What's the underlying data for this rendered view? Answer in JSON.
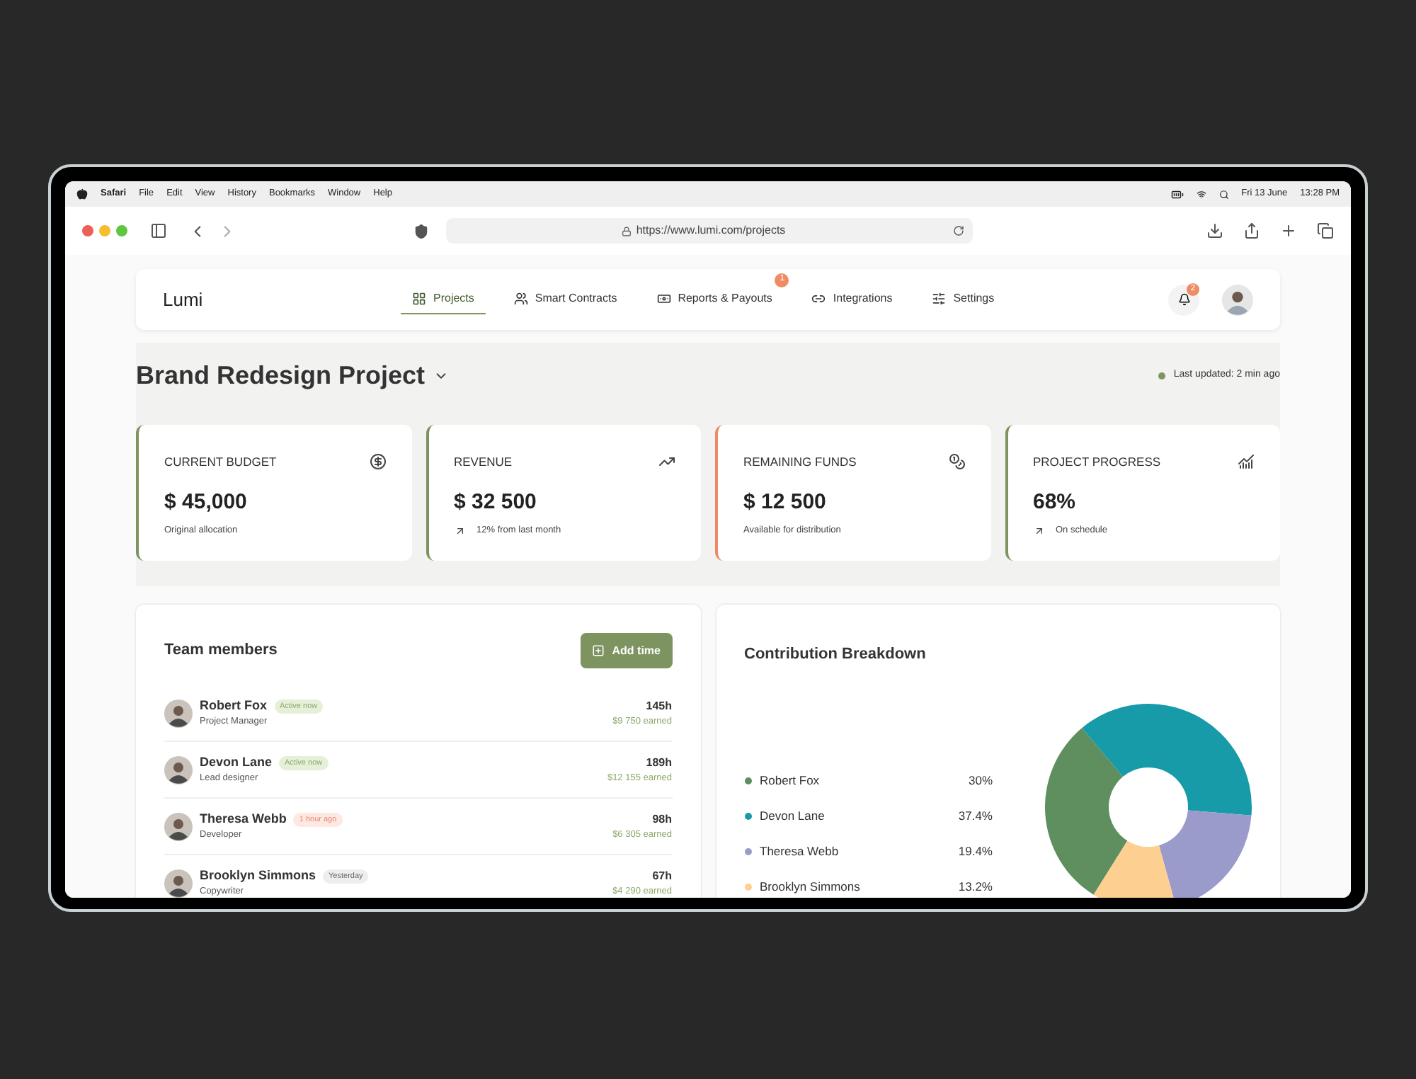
{
  "menubar": {
    "items": [
      "Safari",
      "File",
      "Edit",
      "View",
      "History",
      "Bookmarks",
      "Window",
      "Help"
    ],
    "date": "Fri 13 June",
    "time": "13:28 PM"
  },
  "browser": {
    "url": "https://www.lumi.com/projects"
  },
  "header": {
    "logo": "Lumi",
    "notifications": "2",
    "nav": [
      {
        "label": "Projects",
        "selected": true
      },
      {
        "label": "Smart Contracts",
        "selected": false
      },
      {
        "label": "Reports & Payouts",
        "selected": false,
        "badge": "1"
      },
      {
        "label": "Integrations",
        "selected": false
      },
      {
        "label": "Settings",
        "selected": false
      }
    ]
  },
  "project": {
    "title": "Brand Redesign Project",
    "updated": "Last updated: 2 min ago"
  },
  "stats": [
    {
      "label": "CURRENT BUDGET",
      "value": "$ 45,000",
      "note": "Original allocation",
      "trend": false,
      "color": "#7d9460"
    },
    {
      "label": "REVENUE",
      "value": "$ 32 500",
      "note": "12% from last month",
      "trend": true,
      "color": "#7d9460"
    },
    {
      "label": "REMAINING FUNDS",
      "value": "$ 12 500",
      "note": "Available for distribution",
      "trend": false,
      "color": "#ec8a68"
    },
    {
      "label": "PROJECT PROGRESS",
      "value": "68%",
      "note": "On schedule",
      "trend": true,
      "color": "#7d9460"
    }
  ],
  "team": {
    "title": "Team members",
    "button": "Add time",
    "members": [
      {
        "name": "Robert Fox",
        "role": "Project Manager",
        "status": "Active now",
        "kind": "active",
        "hours": "145h",
        "earned": "$9 750 earned"
      },
      {
        "name": "Devon Lane",
        "role": "Lead designer",
        "status": "Active now",
        "kind": "active",
        "hours": "189h",
        "earned": "$12 155 earned"
      },
      {
        "name": "Theresa Webb",
        "role": "Developer",
        "status": "1 hour ago",
        "kind": "recent",
        "hours": "98h",
        "earned": "$6 305 earned"
      },
      {
        "name": "Brooklyn Simmons",
        "role": "Copywriter",
        "status": "Yesterday",
        "kind": "away",
        "hours": "67h",
        "earned": "$4 290 earned"
      }
    ]
  },
  "contribution": {
    "title": "Contribution Breakdown",
    "legend": [
      {
        "value": "30%",
        "color": "#5f8f5e"
      },
      {
        "value": "37.4%",
        "color": "#179ba9"
      },
      {
        "value": "19.4%",
        "color": "#9b9bcb"
      },
      {
        "value": "13.2%",
        "color": "#fdcf90"
      }
    ],
    "chart_data": {
      "type": "donut",
      "categories": [
        "Robert Fox",
        "Devon Lane",
        "Theresa Webb",
        "Brooklyn Simmons"
      ],
      "values": [
        30,
        37.4,
        19.4,
        13.2
      ]
    }
  }
}
